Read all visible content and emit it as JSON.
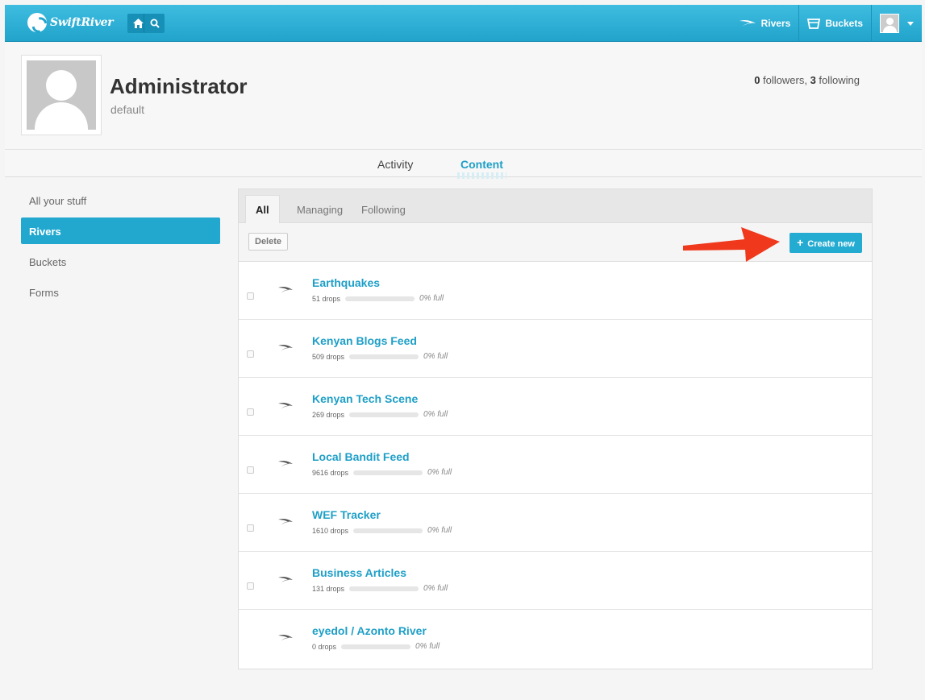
{
  "header": {
    "logo_text": "SwiftRiver",
    "nav": [
      {
        "label": "Rivers",
        "icon": "river-icon"
      },
      {
        "label": "Buckets",
        "icon": "bucket-icon"
      }
    ]
  },
  "profile": {
    "name": "Administrator",
    "subtitle": "default",
    "followers_count": "0",
    "followers_label": " followers, ",
    "following_count": "3",
    "following_label": " following"
  },
  "main_tabs": [
    {
      "label": "Activity",
      "active": false
    },
    {
      "label": "Content",
      "active": true
    }
  ],
  "sidebar": {
    "items": [
      {
        "label": "All your stuff",
        "active": false
      },
      {
        "label": "Rivers",
        "active": true
      },
      {
        "label": "Buckets",
        "active": false
      },
      {
        "label": "Forms",
        "active": false
      }
    ]
  },
  "content": {
    "subtabs": [
      {
        "label": "All",
        "active": true
      },
      {
        "label": "Managing",
        "active": false
      },
      {
        "label": "Following",
        "active": false
      }
    ],
    "delete_label": "Delete",
    "create_label": "Create new",
    "rivers": [
      {
        "title": "Earthquakes",
        "drops": "51 drops",
        "full_label": "0% full",
        "fill": 0,
        "checkbox": true
      },
      {
        "title": "Kenyan Blogs Feed",
        "drops": "509 drops",
        "full_label": "0% full",
        "fill": 0,
        "checkbox": true
      },
      {
        "title": "Kenyan Tech Scene",
        "drops": "269 drops",
        "full_label": "0% full",
        "fill": 0,
        "checkbox": true
      },
      {
        "title": "Local Bandit Feed",
        "drops": "9616 drops",
        "full_label": "0% full",
        "fill": 0,
        "checkbox": true
      },
      {
        "title": "WEF Tracker",
        "drops": "1610 drops",
        "full_label": "0% full",
        "fill": 0,
        "checkbox": true
      },
      {
        "title": "Business Articles",
        "drops": "131 drops",
        "full_label": "0% full",
        "fill": 0,
        "checkbox": true
      },
      {
        "title": "eyedol / Azonto River",
        "drops": "0 drops",
        "full_label": "0% full",
        "fill": 0,
        "checkbox": false
      }
    ]
  },
  "colors": {
    "accent": "#22a8cf",
    "link": "#1e9fc7",
    "annotation_arrow": "#f0391c"
  }
}
